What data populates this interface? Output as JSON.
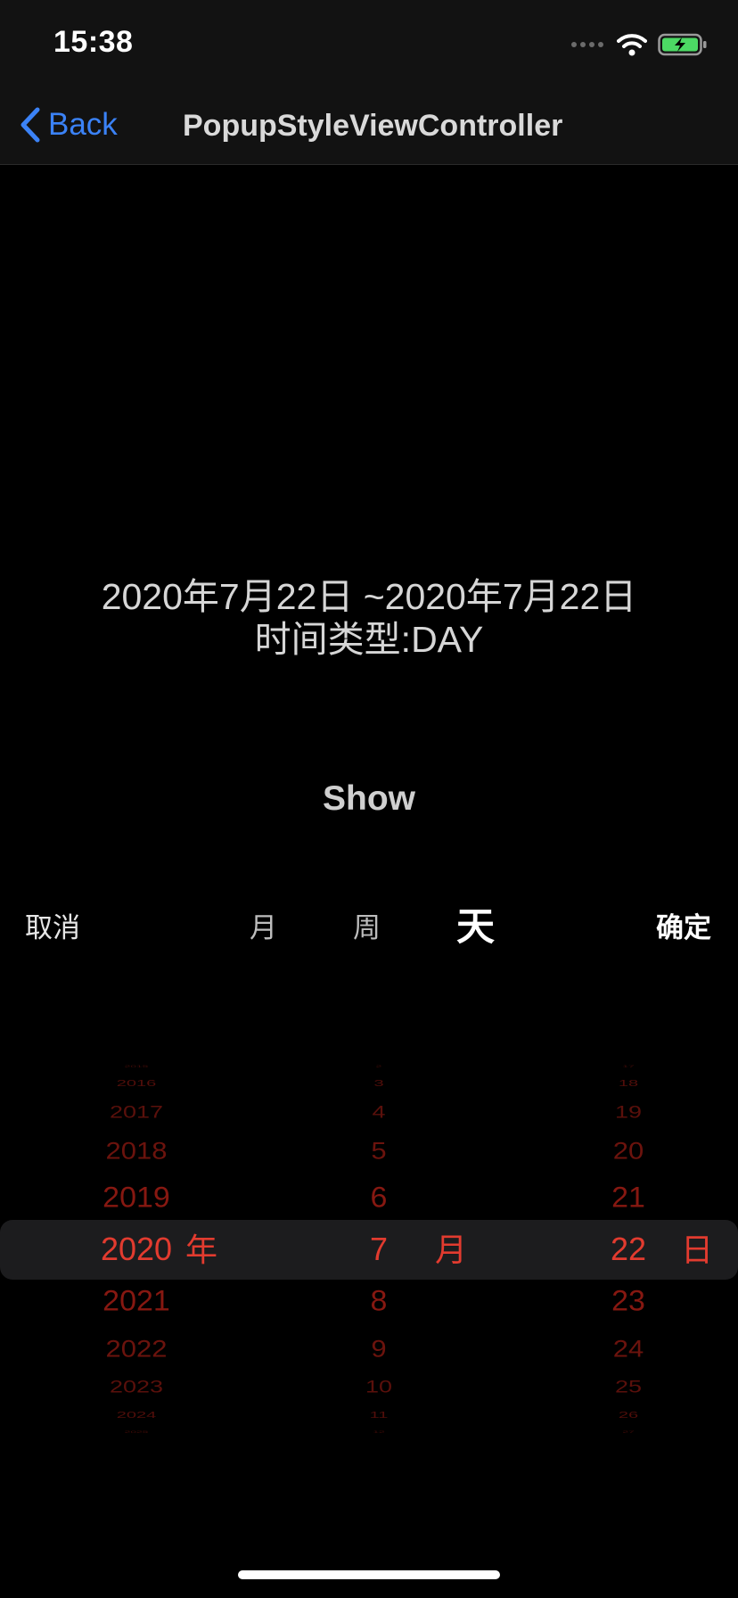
{
  "status_bar": {
    "time": "15:38"
  },
  "nav": {
    "back_label": "Back",
    "title": "PopupStyleViewController"
  },
  "content": {
    "range_text": "2020年7月22日 ~2020年7月22日",
    "type_text": "时间类型:DAY",
    "show_label": "Show"
  },
  "toolbar": {
    "cancel_label": "取消",
    "segment_month": "月",
    "segment_week": "周",
    "segment_day": "天",
    "selected_segment": "天",
    "confirm_label": "确定"
  },
  "picker": {
    "year_rows": [
      "2015",
      "2016",
      "2017",
      "2018",
      "2019",
      "2020",
      "2021",
      "2022",
      "2023",
      "2024",
      "2025"
    ],
    "month_rows": [
      "2",
      "3",
      "4",
      "5",
      "6",
      "7",
      "8",
      "9",
      "10",
      "11",
      "12"
    ],
    "day_rows": [
      "17",
      "18",
      "19",
      "20",
      "21",
      "22",
      "23",
      "24",
      "25",
      "26",
      "27"
    ],
    "year_unit": "年",
    "month_unit": "月",
    "day_unit": "日",
    "selected": {
      "year": "2020",
      "month": "7",
      "day": "22"
    }
  },
  "colors": {
    "accent_blue": "#3b82f6",
    "picker_red": "#e23b2f",
    "background": "#000000",
    "battery_green": "#4cd964"
  }
}
